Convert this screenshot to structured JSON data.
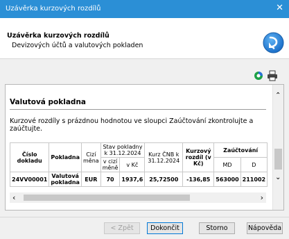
{
  "window": {
    "title": "Uzávěrka kurzových rozdílů",
    "close_glyph": "✕"
  },
  "header": {
    "title": "Uzávěrka kurzových rozdílů",
    "subtitle": "Devizových účtů a valutových pokladen",
    "icon": "wizard-arrow-icon"
  },
  "toolbar": {
    "icons": [
      "refresh-icon",
      "print-icon"
    ]
  },
  "content": {
    "section_title": "Valutová pokladna",
    "note": "Kurzové rozdíly s prázdnou hodnotou ve sloupci Zaúčtování zkontrolujte a zaúčtujte.",
    "table": {
      "headers": {
        "cislo": "Číslo dokladu",
        "pokladna": "Pokladna",
        "cizi_mena": "Cizí měna",
        "stav": "Stav pokladny k 31.12.2024",
        "stav_v_cizi": "v cizí měně",
        "stav_v_kc": "v Kč",
        "kurz": "Kurz ČNB k 31.12.2024",
        "rozdil": "Kurzový rozdíl (v Kč)",
        "zauctovani": "Zaúčtování",
        "md": "MD",
        "d": "D"
      },
      "rows": [
        {
          "cislo": "24VV00001",
          "pokladna": "Valutová pokladna",
          "mena": "EUR",
          "v_cizi": "70",
          "v_kc": "1937,6",
          "kurz": "25,72500",
          "rozdil": "-136,85",
          "md": "563000",
          "d": "211002"
        }
      ]
    }
  },
  "buttons": {
    "back": "< Zpět",
    "finish": "Dokončit",
    "cancel": "Storno",
    "help": "Nápověda"
  },
  "colors": {
    "titlebar": "#2b8fd6",
    "wizard_icon": "#1b6fc9"
  }
}
